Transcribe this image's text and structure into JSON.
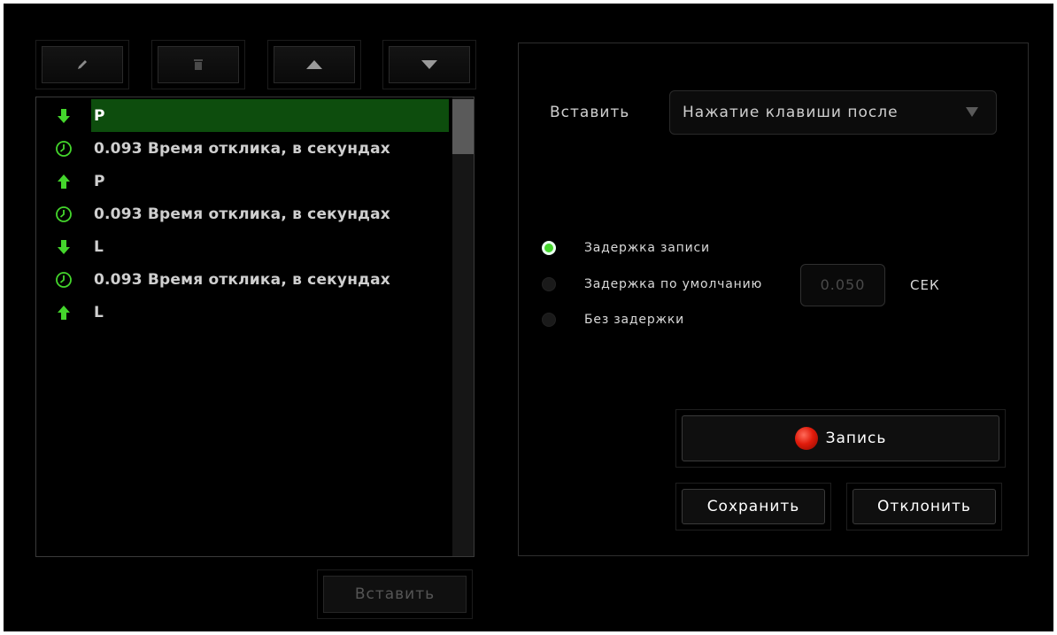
{
  "toolbar": {
    "edit_icon": "pencil-icon",
    "delete_icon": "trash-icon",
    "up_icon": "arrow-up-icon",
    "down_icon": "arrow-down-icon"
  },
  "macro_list": {
    "items": [
      {
        "icon": "key-down-arrow-icon",
        "text": "P",
        "selected": true
      },
      {
        "icon": "clock-icon",
        "text": "0.093 Время отклика, в секундах",
        "selected": false
      },
      {
        "icon": "key-up-arrow-icon",
        "text": "P",
        "selected": false
      },
      {
        "icon": "clock-icon",
        "text": "0.093 Время отклика, в секундах",
        "selected": false
      },
      {
        "icon": "key-down-arrow-icon",
        "text": "L",
        "selected": false
      },
      {
        "icon": "clock-icon",
        "text": "0.093 Время отклика, в секундах",
        "selected": false
      },
      {
        "icon": "key-up-arrow-icon",
        "text": "L",
        "selected": false
      }
    ],
    "insert_button": "Вставить"
  },
  "settings": {
    "insert_label": "Вставить",
    "insert_select_value": "Нажатие клавиши после",
    "delay_options": [
      {
        "label": "Задержка записи",
        "selected": true
      },
      {
        "label": "Задержка по умолчанию",
        "selected": false
      },
      {
        "label": "Без задержки",
        "selected": false
      }
    ],
    "default_delay_value": "0.050",
    "default_delay_unit": "СЕК",
    "record_button": "Запись",
    "save_button": "Сохранить",
    "cancel_button": "Отклонить"
  },
  "colors": {
    "accent_green": "#44d62c",
    "selected_row": "#0d4d0d",
    "record_red": "#e01b0b",
    "background": "#000000"
  }
}
